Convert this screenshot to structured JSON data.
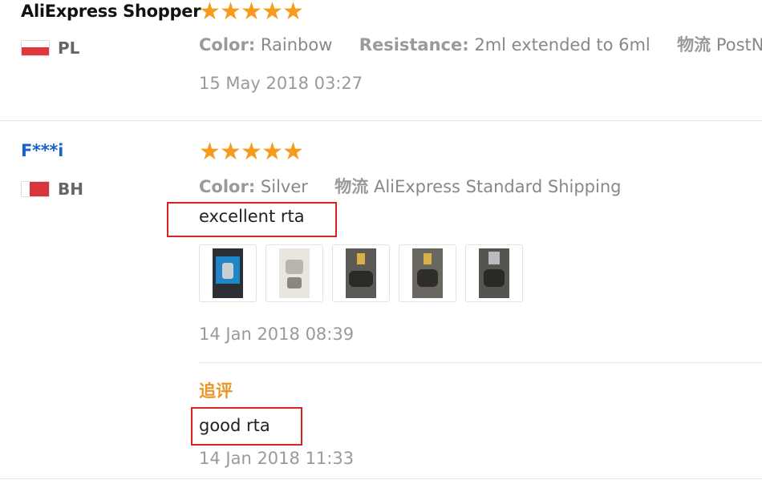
{
  "reviews": [
    {
      "username": "AliExpress Shopper",
      "country": "PL",
      "color_key": "Color:",
      "color_value": "Rainbow",
      "resistance_key": "Resistance:",
      "resistance_value": "2ml extended to 6ml",
      "shipping_key": "物流",
      "shipping_value": "PostNL",
      "date": "15 May 2018 03:27"
    },
    {
      "username": "F***i",
      "country": "BH",
      "color_key": "Color:",
      "color_value": "Silver",
      "shipping_key": "物流",
      "shipping_value": "AliExpress Standard Shipping",
      "text": "excellent rta",
      "date": "14 Jan 2018 08:39",
      "followup_label": "追评",
      "followup_text": "good rta",
      "followup_date": "14 Jan 2018 11:33"
    }
  ],
  "colors": {
    "username_1": "#111111",
    "username_2": "#1b62c6",
    "stars": "#f79b1d",
    "followup_label": "#e8962a",
    "highlight_border": "#d62424"
  }
}
